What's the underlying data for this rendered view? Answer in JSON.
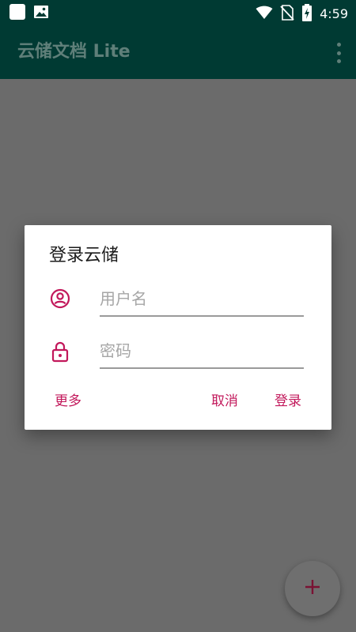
{
  "status_bar": {
    "time": "4:59",
    "icons": [
      "notification-square-icon",
      "image-icon",
      "wifi-icon",
      "no-sim-icon",
      "battery-charging-icon"
    ]
  },
  "app_bar": {
    "title": "云储文档 Lite",
    "menu_icon": "overflow-menu-icon"
  },
  "dialog": {
    "title": "登录云储",
    "username": {
      "icon": "account-circle-icon",
      "placeholder": "用户名",
      "value": ""
    },
    "password": {
      "icon": "lock-icon",
      "placeholder": "密码",
      "value": ""
    },
    "actions": {
      "more": "更多",
      "cancel": "取消",
      "login": "登录"
    }
  },
  "fab": {
    "icon": "plus-icon",
    "label": "+"
  },
  "colors": {
    "primary_dark": "#003a33",
    "accent": "#c2185b",
    "scrim": "#6b6b6b",
    "dialog_bg": "#ffffff"
  }
}
